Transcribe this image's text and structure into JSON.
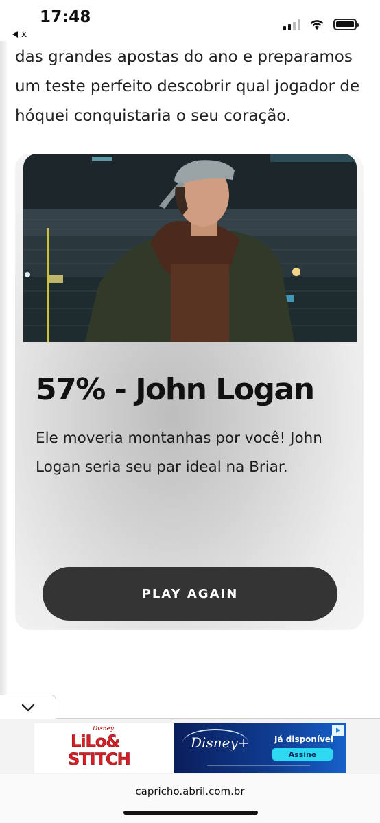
{
  "status_bar": {
    "time": "17:48",
    "back_label": "x",
    "signal_bars": 4,
    "signal_bars_active": 2,
    "icons": [
      "signal-icon",
      "wifi-icon",
      "battery-icon",
      "back-arrow-icon"
    ]
  },
  "article": {
    "text": "das grandes apostas do ano e preparamos um teste perfeito descobrir qual jogador de hóquei conquistaria o seu coração."
  },
  "result": {
    "image_alt": "",
    "title": "57% - John Logan",
    "description": "Ele moveria montanhas por você! John Logan seria seu par ideal na Briar.",
    "play_again_label": "PLAY AGAIN"
  },
  "ad": {
    "collapse_icon": "chevron-down-icon",
    "left_brand_small": "Disney",
    "left_brand_line1": "LiLo&",
    "left_brand_line2": "STITCH",
    "right_brand": "Disney+",
    "right_headline": "Já disponível",
    "right_cta": "Assine",
    "adchoices_icon": "adchoices-icon"
  },
  "browser": {
    "url": "capricho.abril.com.br"
  },
  "colors": {
    "button_bg": "#343434",
    "ad_blue": "#0f3b8f",
    "ad_cta": "#2dd8f0",
    "lilo_red": "#d61f26"
  }
}
